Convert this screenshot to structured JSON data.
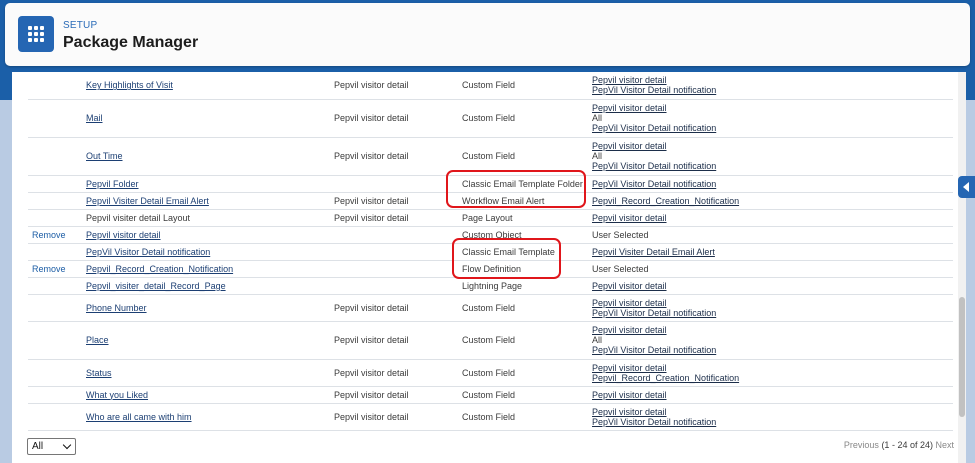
{
  "header": {
    "setup_label": "SETUP",
    "title": "Package Manager",
    "app_icon": "app-launcher-grid-icon"
  },
  "rows": [
    {
      "action": "",
      "name": "Key Highlights of Visit",
      "name_link": true,
      "parent": "Pepvil visitor detail",
      "type": "Custom Field",
      "included_by": [
        {
          "text": "Pepvil visitor detail",
          "link": true
        },
        {
          "text": "PepVil Visitor Detail notification",
          "link": true
        }
      ]
    },
    {
      "action": "",
      "name": "Mail",
      "name_link": true,
      "parent": "Pepvil visitor detail",
      "type": "Custom Field",
      "included_by": [
        {
          "text": "Pepvil visitor detail",
          "link": true
        },
        {
          "text": "All",
          "link": false
        },
        {
          "text": "PepVil Visitor Detail notification",
          "link": true
        }
      ]
    },
    {
      "action": "",
      "name": "Out Time",
      "name_link": true,
      "parent": "Pepvil visitor detail",
      "type": "Custom Field",
      "included_by": [
        {
          "text": "Pepvil visitor detail",
          "link": true
        },
        {
          "text": "All",
          "link": false
        },
        {
          "text": "PepVil Visitor Detail notification",
          "link": true
        }
      ]
    },
    {
      "action": "",
      "name": "Pepvil Folder",
      "name_link": true,
      "parent": "",
      "type": "Classic Email Template Folder",
      "included_by": [
        {
          "text": "PepVil Visitor Detail notification",
          "link": true
        }
      ]
    },
    {
      "action": "",
      "name": "Pepvil Visiter Detail Email Alert",
      "name_link": true,
      "parent": "Pepvil visitor detail",
      "type": "Workflow Email Alert",
      "included_by": [
        {
          "text": "Pepvil_Record_Creation_Notification",
          "link": true
        }
      ]
    },
    {
      "action": "",
      "name": "Pepvil visiter detail Layout",
      "name_link": false,
      "parent": "Pepvil visitor detail",
      "type": "Page Layout",
      "included_by": [
        {
          "text": "Pepvil visitor detail",
          "link": true
        }
      ]
    },
    {
      "action": "Remove",
      "name": "Pepvil visitor detail",
      "name_link": true,
      "parent": "",
      "type": "Custom Object",
      "included_by": [
        {
          "text": "User Selected",
          "link": false
        }
      ]
    },
    {
      "action": "",
      "name": "PepVil Visitor Detail notification",
      "name_link": true,
      "parent": "",
      "type": "Classic Email Template",
      "included_by": [
        {
          "text": "Pepvil Visiter Detail Email Alert",
          "link": true
        }
      ]
    },
    {
      "action": "Remove",
      "name": "Pepvil_Record_Creation_Notification",
      "name_link": true,
      "parent": "",
      "type": "Flow Definition",
      "included_by": [
        {
          "text": "User Selected",
          "link": false
        }
      ]
    },
    {
      "action": "",
      "name": "Pepvil_visiter_detail_Record_Page",
      "name_link": true,
      "parent": "",
      "type": "Lightning Page",
      "included_by": [
        {
          "text": "Pepvil visitor detail",
          "link": true
        }
      ]
    },
    {
      "action": "",
      "name": "Phone Number",
      "name_link": true,
      "parent": "Pepvil visitor detail",
      "type": "Custom Field",
      "included_by": [
        {
          "text": "Pepvil visitor detail",
          "link": true
        },
        {
          "text": "PepVil Visitor Detail notification",
          "link": true
        }
      ]
    },
    {
      "action": "",
      "name": "Place",
      "name_link": true,
      "parent": "Pepvil visitor detail",
      "type": "Custom Field",
      "included_by": [
        {
          "text": "Pepvil visitor detail",
          "link": true
        },
        {
          "text": "All",
          "link": false
        },
        {
          "text": "PepVil Visitor Detail notification",
          "link": true
        }
      ]
    },
    {
      "action": "",
      "name": "Status",
      "name_link": true,
      "parent": "Pepvil visitor detail",
      "type": "Custom Field",
      "included_by": [
        {
          "text": "Pepvil visitor detail",
          "link": true
        },
        {
          "text": "Pepvil_Record_Creation_Notification",
          "link": true
        }
      ]
    },
    {
      "action": "",
      "name": "What you Liked",
      "name_link": true,
      "parent": "Pepvil visitor detail",
      "type": "Custom Field",
      "included_by": [
        {
          "text": "Pepvil visitor detail",
          "link": true
        }
      ]
    },
    {
      "action": "",
      "name": "Who are all came with him",
      "name_link": true,
      "parent": "Pepvil visitor detail",
      "type": "Custom Field",
      "included_by": [
        {
          "text": "Pepvil visitor detail",
          "link": true
        },
        {
          "text": "PepVil Visitor Detail notification",
          "link": true
        }
      ]
    }
  ],
  "footer": {
    "filter_value": "All",
    "pager_previous": "Previous",
    "pager_range": "(1 - 24 of 24)",
    "pager_next": "Next"
  },
  "colors": {
    "brand": "#1b5fa8",
    "highlight": "#e0161b"
  }
}
